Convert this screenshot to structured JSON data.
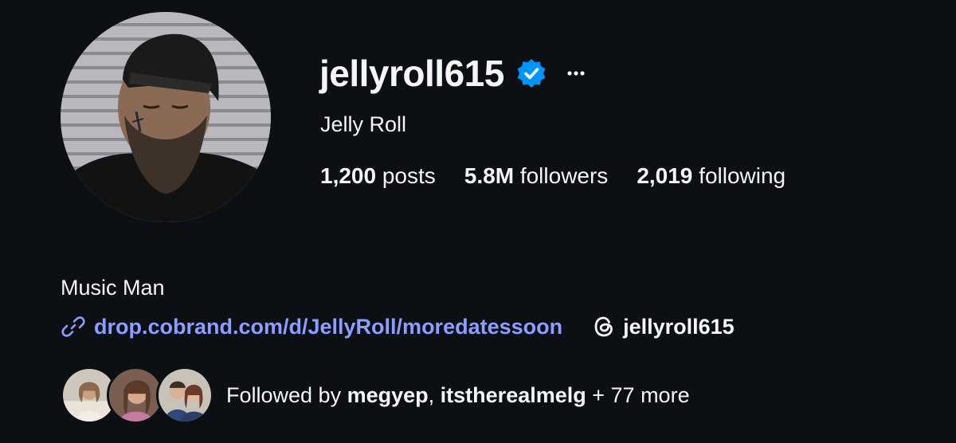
{
  "profile": {
    "username": "jellyroll615",
    "verified": true,
    "full_name": "Jelly Roll",
    "more_label": "···"
  },
  "stats": {
    "posts_count": "1,200",
    "posts_label": "posts",
    "followers_count": "5.8M",
    "followers_label": "followers",
    "following_count": "2,019",
    "following_label": "following"
  },
  "bio": {
    "text": "Music Man",
    "link": "drop.cobrand.com/d/JellyRoll/moredatessoon",
    "threads_handle": "jellyroll615"
  },
  "followed_by": {
    "prefix": "Followed by",
    "user1": "megyep",
    "separator": ",",
    "user2": "itstherealmelg",
    "suffix": "+ 77 more"
  },
  "icons": {
    "verified": "verified-badge-icon",
    "more": "more-options-icon",
    "link": "link-icon",
    "threads": "threads-icon"
  },
  "colors": {
    "background": "#0c1014",
    "text": "#f5f5f5",
    "link": "#8c9eff",
    "verified": "#0095f6"
  }
}
